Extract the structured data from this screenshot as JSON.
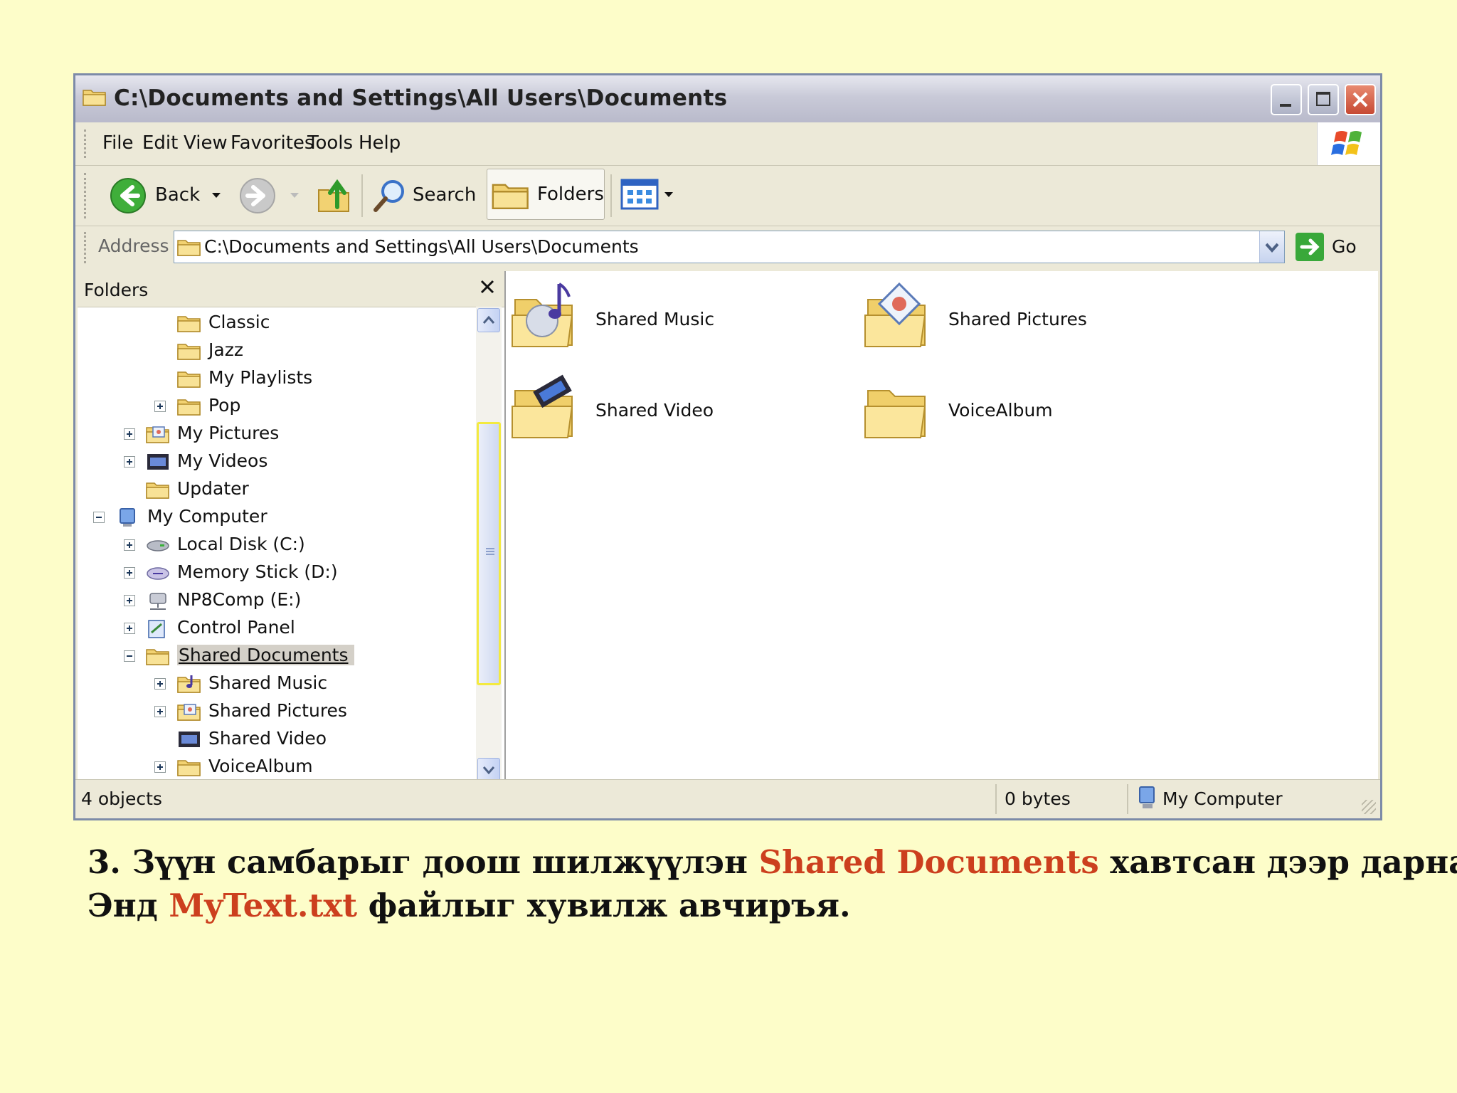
{
  "window": {
    "title": "C:\\Documents and Settings\\All Users\\Documents"
  },
  "menu": {
    "items": [
      "File",
      "Edit",
      "View",
      "Favorites",
      "Tools",
      "Help"
    ]
  },
  "toolbar": {
    "back": "Back",
    "search": "Search",
    "folders": "Folders"
  },
  "address": {
    "label": "Address",
    "value": "C:\\Documents and Settings\\All Users\\Documents",
    "go": "Go"
  },
  "folders_panel": {
    "title": "Folders",
    "tree": [
      {
        "label": "Classic",
        "icon": "folder-icon",
        "expander": "none"
      },
      {
        "label": "Jazz",
        "icon": "folder-icon",
        "expander": "none"
      },
      {
        "label": "My Playlists",
        "icon": "folder-icon",
        "expander": "none"
      },
      {
        "label": "Pop",
        "icon": "folder-icon",
        "expander": "plus"
      },
      {
        "label": "My Pictures",
        "icon": "pictures-folder-icon",
        "expander": "plus"
      },
      {
        "label": "My Videos",
        "icon": "videos-folder-icon",
        "expander": "plus"
      },
      {
        "label": "Updater",
        "icon": "folder-icon",
        "expander": "none"
      },
      {
        "label": "My Computer",
        "icon": "computer-icon",
        "expander": "minus"
      },
      {
        "label": "Local Disk (C:)",
        "icon": "hard-disk-icon",
        "expander": "plus"
      },
      {
        "label": "Memory Stick (D:)",
        "icon": "memory-stick-icon",
        "expander": "plus"
      },
      {
        "label": "NP8Comp (E:)",
        "icon": "network-drive-icon",
        "expander": "plus"
      },
      {
        "label": "Control Panel",
        "icon": "control-panel-icon",
        "expander": "plus"
      },
      {
        "label": "Shared Documents",
        "icon": "folder-icon",
        "expander": "minus",
        "selected": true
      },
      {
        "label": "Shared Music",
        "icon": "music-folder-icon",
        "expander": "plus"
      },
      {
        "label": "Shared Pictures",
        "icon": "pictures-folder-icon",
        "expander": "plus"
      },
      {
        "label": "Shared Video",
        "icon": "videos-folder-icon",
        "expander": "none"
      },
      {
        "label": "VoiceAlbum",
        "icon": "folder-icon",
        "expander": "plus"
      }
    ]
  },
  "content": {
    "items": [
      {
        "label": "Shared Music",
        "icon": "music-folder-icon"
      },
      {
        "label": "Shared Pictures",
        "icon": "pictures-folder-icon"
      },
      {
        "label": "Shared Video",
        "icon": "video-folder-icon"
      },
      {
        "label": "VoiceAlbum",
        "icon": "folder-icon"
      }
    ]
  },
  "status": {
    "objects": "4 objects",
    "size": "0 bytes",
    "location": "My Computer"
  },
  "caption": {
    "line1_a": "3. Зүүн самбарыг доош шилжүүлэн ",
    "line1_hl": "Shared Documents",
    "line1_b": " хавтсан дээр дарна.",
    "line2_a": "Энд ",
    "line2_hl": "MyText.txt",
    "line2_b": " файлыг хувилж авчиръя."
  },
  "colors": {
    "background": "#fdfdc9",
    "highlight_text": "#cc3f1e",
    "folder_yellow": "#f5d76e"
  }
}
